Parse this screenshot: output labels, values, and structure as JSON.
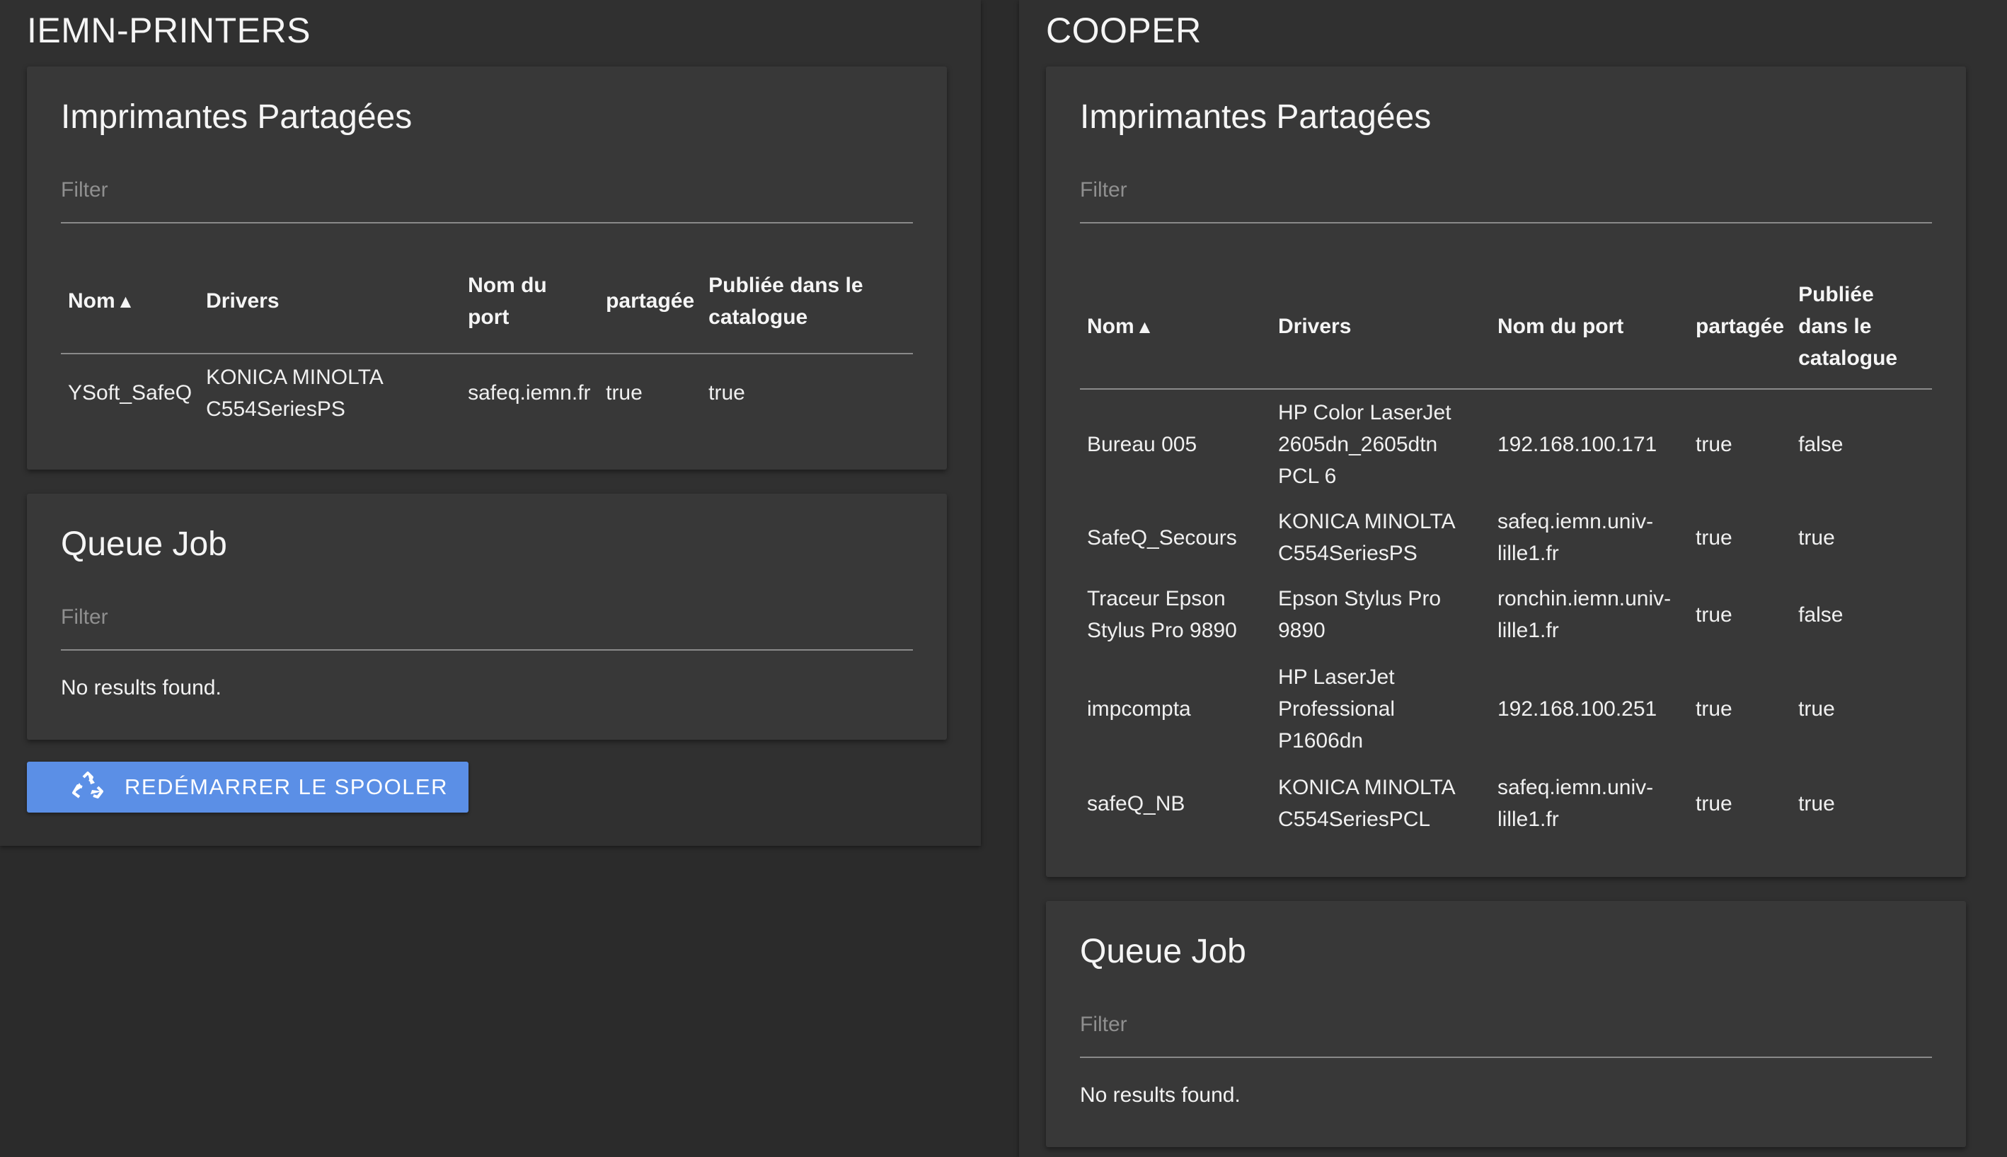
{
  "left": {
    "title": "IEMN-PRINTERS",
    "printers_card": {
      "title": "Imprimantes Partagées",
      "filter_placeholder": "Filter",
      "columns": [
        "Nom",
        "Drivers",
        "Nom du port",
        "partagée",
        "Publiée dans le catalogue"
      ],
      "sort_indicator": "▲",
      "rows": [
        {
          "name": "YSoft_SafeQ",
          "driver": "KONICA MINOLTA C554SeriesPS",
          "port": "safeq.iemn.fr",
          "shared": "true",
          "published": "true"
        }
      ]
    },
    "queue_card": {
      "title": "Queue Job",
      "filter_placeholder": "Filter",
      "empty_text": "No results found."
    },
    "restart_button": {
      "label": "REDÉMARRER LE SPOOLER",
      "icon": "recycle-icon"
    }
  },
  "right": {
    "title": "COOPER",
    "printers_card": {
      "title": "Imprimantes Partagées",
      "filter_placeholder": "Filter",
      "columns": [
        "Nom",
        "Drivers",
        "Nom du port",
        "partagée",
        "Publiée dans le catalogue"
      ],
      "sort_indicator": "▲",
      "rows": [
        {
          "name": "Bureau 005",
          "driver": "HP Color LaserJet 2605dn_2605dtn PCL 6",
          "port": "192.168.100.171",
          "shared": "true",
          "published": "false"
        },
        {
          "name": "SafeQ_Secours",
          "driver": "KONICA MINOLTA C554SeriesPS",
          "port": "safeq.iemn.univ-lille1.fr",
          "shared": "true",
          "published": "true"
        },
        {
          "name": "Traceur Epson Stylus Pro 9890",
          "driver": "Epson Stylus Pro 9890",
          "port": "ronchin.iemn.univ-lille1.fr",
          "shared": "true",
          "published": "false"
        },
        {
          "name": "impcompta",
          "driver": "HP LaserJet Professional P1606dn",
          "port": "192.168.100.251",
          "shared": "true",
          "published": "true"
        },
        {
          "name": "safeQ_NB",
          "driver": "KONICA MINOLTA C554SeriesPCL",
          "port": "safeq.iemn.univ-lille1.fr",
          "shared": "true",
          "published": "true"
        }
      ]
    },
    "queue_card": {
      "title": "Queue Job",
      "filter_placeholder": "Filter",
      "empty_text": "No results found."
    }
  },
  "colors": {
    "background": "#2b2b2b",
    "card": "#383838",
    "button": "#5b8fe6"
  }
}
